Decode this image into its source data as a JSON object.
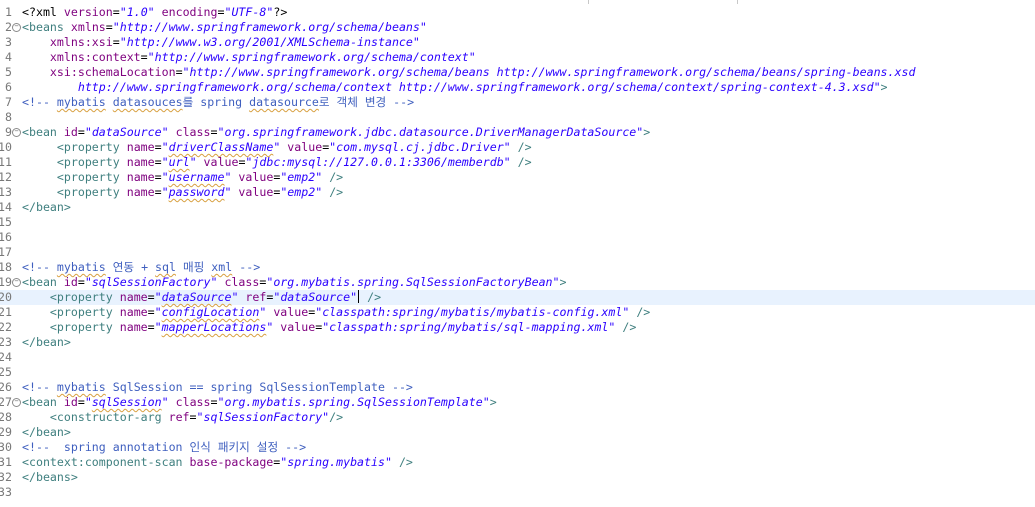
{
  "editor": {
    "current_line": 20,
    "lines": [
      {
        "n": "1",
        "segs": [
          [
            "plain",
            "<?xml "
          ],
          [
            "attr",
            "version"
          ],
          [
            "plain",
            "="
          ],
          [
            "val",
            "\"1.0\""
          ],
          [
            "plain",
            " "
          ],
          [
            "attr",
            "encoding"
          ],
          [
            "plain",
            "="
          ],
          [
            "val",
            "\"UTF-8\""
          ],
          [
            "plain",
            "?>"
          ]
        ]
      },
      {
        "n": "2",
        "fold": true,
        "segs": [
          [
            "tag",
            "<beans "
          ],
          [
            "attr",
            "xmlns"
          ],
          [
            "plain",
            "="
          ],
          [
            "val",
            "\"http://www.springframework.org/schema/beans\""
          ]
        ]
      },
      {
        "n": "3",
        "segs": [
          [
            "plain",
            "    "
          ],
          [
            "attr",
            "xmlns:xsi"
          ],
          [
            "plain",
            "="
          ],
          [
            "val",
            "\"http://www.w3.org/2001/XMLSchema-instance\""
          ]
        ]
      },
      {
        "n": "4",
        "segs": [
          [
            "plain",
            "    "
          ],
          [
            "attr",
            "xmlns:context"
          ],
          [
            "plain",
            "="
          ],
          [
            "val",
            "\"http://www.springframework.org/schema/context\""
          ]
        ]
      },
      {
        "n": "5",
        "segs": [
          [
            "plain",
            "    "
          ],
          [
            "attr",
            "xsi:schemaLocation"
          ],
          [
            "plain",
            "="
          ],
          [
            "val",
            "\"http://www.springframework.org/schema/beans http://www.springframework.org/schema/beans/spring-beans.xsd"
          ]
        ]
      },
      {
        "n": "6",
        "segs": [
          [
            "val",
            "        http://www.springframework.org/schema/context http://www.springframework.org/schema/context/spring-context-4.3.xsd\""
          ],
          [
            "tag",
            ">"
          ]
        ]
      },
      {
        "n": "7",
        "segs": [
          [
            "cmt",
            "<!-- "
          ],
          [
            "cmt sq",
            "mybatis"
          ],
          [
            "cmt",
            " "
          ],
          [
            "cmt sq",
            "datasouces"
          ],
          [
            "cmt",
            "를 spring "
          ],
          [
            "cmt sq",
            "datasource"
          ],
          [
            "cmt",
            "로 객체 변경 -->"
          ]
        ]
      },
      {
        "n": "8",
        "segs": []
      },
      {
        "n": "9",
        "fold": true,
        "segs": [
          [
            "tag",
            "<bean "
          ],
          [
            "attr",
            "id"
          ],
          [
            "plain",
            "="
          ],
          [
            "val",
            "\"dataSource\""
          ],
          [
            "plain",
            " "
          ],
          [
            "attr",
            "class"
          ],
          [
            "plain",
            "="
          ],
          [
            "val",
            "\"org.springframework.jdbc.datasource.DriverManagerDataSource\""
          ],
          [
            "tag",
            ">"
          ]
        ]
      },
      {
        "n": "10",
        "segs": [
          [
            "plain",
            "     "
          ],
          [
            "tag",
            "<property "
          ],
          [
            "attr",
            "name"
          ],
          [
            "plain",
            "="
          ],
          [
            "val",
            "\""
          ],
          [
            "val sq",
            "driverClassName"
          ],
          [
            "val",
            "\""
          ],
          [
            "plain",
            " "
          ],
          [
            "attr",
            "value"
          ],
          [
            "plain",
            "="
          ],
          [
            "val",
            "\"com.mysql.cj.jdbc.Driver\""
          ],
          [
            "plain",
            " "
          ],
          [
            "tag",
            "/>"
          ]
        ]
      },
      {
        "n": "11",
        "segs": [
          [
            "plain",
            "     "
          ],
          [
            "tag",
            "<property "
          ],
          [
            "attr",
            "name"
          ],
          [
            "plain",
            "="
          ],
          [
            "val",
            "\""
          ],
          [
            "val sq",
            "url"
          ],
          [
            "val",
            "\""
          ],
          [
            "plain",
            " "
          ],
          [
            "attr",
            "value"
          ],
          [
            "plain",
            "="
          ],
          [
            "val",
            "\"jdbc:mysql://127.0.0.1:3306/memberdb\""
          ],
          [
            "plain",
            " "
          ],
          [
            "tag",
            "/>"
          ]
        ]
      },
      {
        "n": "12",
        "segs": [
          [
            "plain",
            "     "
          ],
          [
            "tag",
            "<property "
          ],
          [
            "attr",
            "name"
          ],
          [
            "plain",
            "="
          ],
          [
            "val",
            "\""
          ],
          [
            "val sq",
            "username"
          ],
          [
            "val",
            "\""
          ],
          [
            "plain",
            " "
          ],
          [
            "attr",
            "value"
          ],
          [
            "plain",
            "="
          ],
          [
            "val",
            "\"emp2\""
          ],
          [
            "plain",
            " "
          ],
          [
            "tag",
            "/>"
          ]
        ]
      },
      {
        "n": "13",
        "segs": [
          [
            "plain",
            "     "
          ],
          [
            "tag",
            "<property "
          ],
          [
            "attr",
            "name"
          ],
          [
            "plain",
            "="
          ],
          [
            "val",
            "\""
          ],
          [
            "val sq",
            "password"
          ],
          [
            "val",
            "\""
          ],
          [
            "plain",
            " "
          ],
          [
            "attr",
            "value"
          ],
          [
            "plain",
            "="
          ],
          [
            "val",
            "\"emp2\""
          ],
          [
            "plain",
            " "
          ],
          [
            "tag",
            "/>"
          ]
        ]
      },
      {
        "n": "14",
        "segs": [
          [
            "tag",
            "</bean>"
          ]
        ]
      },
      {
        "n": "15",
        "segs": []
      },
      {
        "n": "16",
        "segs": []
      },
      {
        "n": "17",
        "segs": []
      },
      {
        "n": "18",
        "segs": [
          [
            "cmt",
            "<!-- "
          ],
          [
            "cmt sq",
            "mybatis"
          ],
          [
            "cmt",
            " 연동 + "
          ],
          [
            "cmt sq",
            "sql"
          ],
          [
            "cmt",
            " 매핑 "
          ],
          [
            "cmt sq",
            "xml"
          ],
          [
            "cmt",
            " -->"
          ]
        ]
      },
      {
        "n": "19",
        "fold": true,
        "segs": [
          [
            "tag",
            "<bean "
          ],
          [
            "attr",
            "id"
          ],
          [
            "plain",
            "="
          ],
          [
            "val",
            "\"sqlSessionFactory\""
          ],
          [
            "plain",
            " "
          ],
          [
            "attr",
            "class"
          ],
          [
            "plain",
            "="
          ],
          [
            "val",
            "\"org.mybatis.spring.SqlSessionFactoryBean\""
          ],
          [
            "tag",
            ">"
          ]
        ]
      },
      {
        "n": "20",
        "segs": [
          [
            "plain",
            "    "
          ],
          [
            "tag",
            "<property "
          ],
          [
            "attr",
            "name"
          ],
          [
            "plain",
            "="
          ],
          [
            "val",
            "\""
          ],
          [
            "val sq",
            "dataSource"
          ],
          [
            "val",
            "\""
          ],
          [
            "plain",
            " "
          ],
          [
            "attr",
            "ref"
          ],
          [
            "plain",
            "="
          ],
          [
            "val",
            "\"dataSource\""
          ],
          [
            "caret",
            ""
          ],
          [
            "plain",
            " "
          ],
          [
            "tag",
            "/>"
          ]
        ]
      },
      {
        "n": "21",
        "segs": [
          [
            "plain",
            "    "
          ],
          [
            "tag",
            "<property "
          ],
          [
            "attr",
            "name"
          ],
          [
            "plain",
            "="
          ],
          [
            "val",
            "\""
          ],
          [
            "val sq",
            "configLocation"
          ],
          [
            "val",
            "\""
          ],
          [
            "plain",
            " "
          ],
          [
            "attr",
            "value"
          ],
          [
            "plain",
            "="
          ],
          [
            "val",
            "\"classpath:spring/mybatis/mybatis-config.xml\""
          ],
          [
            "plain",
            " "
          ],
          [
            "tag",
            "/>"
          ]
        ]
      },
      {
        "n": "22",
        "segs": [
          [
            "plain",
            "    "
          ],
          [
            "tag",
            "<property "
          ],
          [
            "attr",
            "name"
          ],
          [
            "plain",
            "="
          ],
          [
            "val",
            "\""
          ],
          [
            "val sq",
            "mapperLocations"
          ],
          [
            "val",
            "\""
          ],
          [
            "plain",
            " "
          ],
          [
            "attr",
            "value"
          ],
          [
            "plain",
            "="
          ],
          [
            "val",
            "\"classpath:spring/mybatis/sql-mapping.xml\""
          ],
          [
            "plain",
            " "
          ],
          [
            "tag",
            "/>"
          ]
        ]
      },
      {
        "n": "23",
        "segs": [
          [
            "tag",
            "</bean>"
          ]
        ]
      },
      {
        "n": "24",
        "segs": []
      },
      {
        "n": "25",
        "segs": []
      },
      {
        "n": "26",
        "segs": [
          [
            "cmt",
            "<!-- "
          ],
          [
            "cmt sq",
            "mybatis"
          ],
          [
            "cmt",
            " SqlSession == spring SqlSessionTemplate -->"
          ]
        ]
      },
      {
        "n": "27",
        "fold": true,
        "segs": [
          [
            "tag",
            "<bean "
          ],
          [
            "attr",
            "id"
          ],
          [
            "plain",
            "="
          ],
          [
            "val",
            "\""
          ],
          [
            "val sq",
            "sqlSession"
          ],
          [
            "val",
            "\""
          ],
          [
            "plain",
            " "
          ],
          [
            "attr",
            "class"
          ],
          [
            "plain",
            "="
          ],
          [
            "val",
            "\"org.mybatis.spring.SqlSessionTemplate\""
          ],
          [
            "tag",
            ">"
          ]
        ]
      },
      {
        "n": "28",
        "segs": [
          [
            "plain",
            "    "
          ],
          [
            "tag",
            "<constructor-arg "
          ],
          [
            "attr",
            "ref"
          ],
          [
            "plain",
            "="
          ],
          [
            "val",
            "\"sqlSessionFactory\""
          ],
          [
            "tag",
            "/>"
          ]
        ]
      },
      {
        "n": "29",
        "segs": [
          [
            "tag",
            "</bean>"
          ]
        ]
      },
      {
        "n": "30",
        "segs": [
          [
            "cmt",
            "<!--  spring annotation 인식 패키지 설정 -->"
          ]
        ]
      },
      {
        "n": "31",
        "segs": [
          [
            "tag",
            "<context:component-scan "
          ],
          [
            "attr",
            "base-package"
          ],
          [
            "plain",
            "="
          ],
          [
            "val",
            "\"spring.mybatis\""
          ],
          [
            "plain",
            " "
          ],
          [
            "tag",
            "/>"
          ]
        ]
      },
      {
        "n": "32",
        "segs": [
          [
            "tag",
            "</beans>"
          ]
        ]
      },
      {
        "n": "33",
        "segs": []
      }
    ]
  }
}
